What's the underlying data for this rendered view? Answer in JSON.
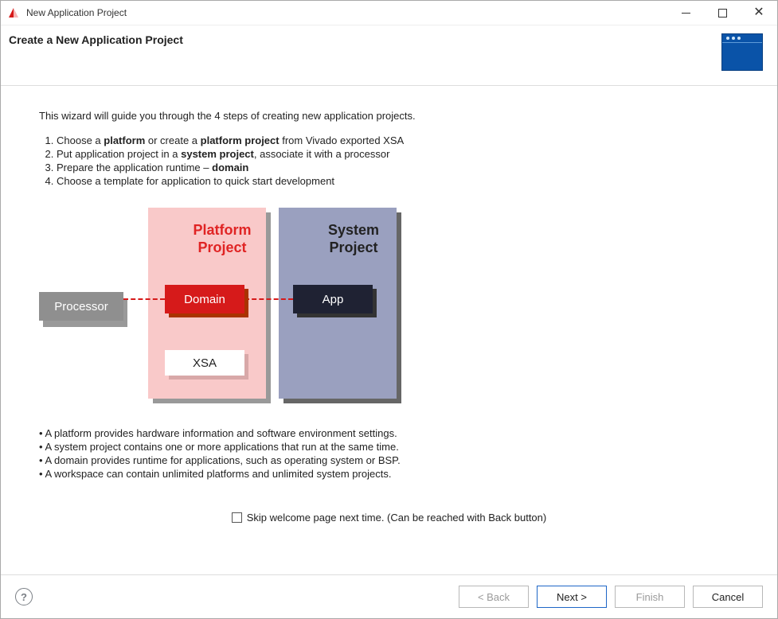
{
  "window": {
    "title": "New Application Project"
  },
  "banner": {
    "heading": "Create a New Application Project"
  },
  "intro": "This wizard will guide you through the 4 steps of creating new application projects.",
  "steps": {
    "s1_pre": "Choose a ",
    "s1_b1": "platform",
    "s1_mid": " or create a ",
    "s1_b2": "platform project",
    "s1_post": " from Vivado exported XSA",
    "s2_pre": "Put application project in a ",
    "s2_b": "system project",
    "s2_post": ", associate it with a processor",
    "s3_pre": "Prepare the application runtime – ",
    "s3_b": "domain",
    "s4": "Choose a template for application to quick start development"
  },
  "diagram": {
    "platform_project": "Platform\nProject",
    "system_project": "System\nProject",
    "processor": "Processor",
    "domain": "Domain",
    "xsa": "XSA",
    "app": "App"
  },
  "bullets": {
    "b1": "A platform provides hardware information and software environment settings.",
    "b2": "A system project contains one or more applications that run at the same time.",
    "b3": "A domain provides runtime for applications, such as operating system or BSP.",
    "b4": "A workspace can contain unlimited platforms and unlimited system projects."
  },
  "skip": {
    "label": "Skip welcome page next time. (Can be reached with Back button)"
  },
  "footer": {
    "back": "< Back",
    "next": "Next >",
    "finish": "Finish",
    "cancel": "Cancel",
    "help": "?"
  }
}
